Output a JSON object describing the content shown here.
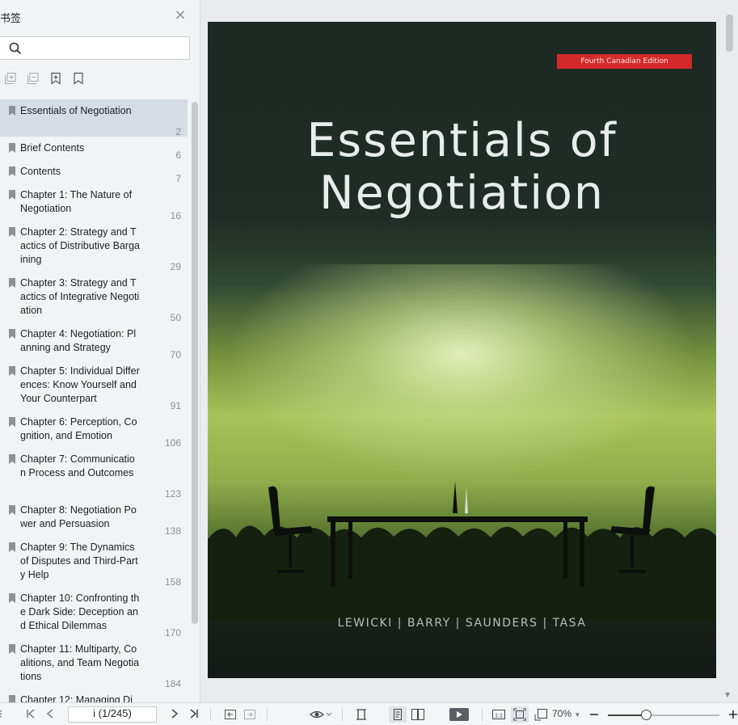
{
  "sidebar": {
    "title": "书签",
    "close_glyph": "×",
    "search": {
      "placeholder": "",
      "value": ""
    },
    "tools": [
      "expand-all-icon",
      "collapse-all-icon",
      "add-bookmark-icon",
      "bookmark-icon"
    ],
    "bookmarks": [
      {
        "label": "Essentials of   Negotiation",
        "page": "2",
        "selected": true
      },
      {
        "label": "Brief Contents",
        "page": "6"
      },
      {
        "label": "Contents",
        "page": "7"
      },
      {
        "label": "Chapter 1:  The Nature of Negotiation",
        "page": "16"
      },
      {
        "label": "Chapter 2:  Strategy and Tactics of Distributive Bargaining",
        "page": "29"
      },
      {
        "label": "Chapter 3:  Strategy and Tactics of Integrative Negotiation",
        "page": "50"
      },
      {
        "label": "Chapter 4:  Negotiation: Planning and Strategy",
        "page": "70"
      },
      {
        "label": "Chapter 5:  Individual Differences: Know Yourself and Your Counterpart",
        "page": "91"
      },
      {
        "label": "Chapter 6:  Perception, Cognition, and Emotion",
        "page": "106"
      },
      {
        "label": "Chapter 7:  Communication Process and Outcomes",
        "page": "123"
      },
      {
        "label": "Chapter 8:  Negotiation Power and Persuasion",
        "page": "138"
      },
      {
        "label": "Chapter 9:  The Dynamics of Disputes and Third-Party Help",
        "page": "158"
      },
      {
        "label": "Chapter 10: Confronting the Dark Side: Deception and  Ethical Dilemmas",
        "page": "170"
      },
      {
        "label": "Chapter 11: Multiparty, Coalitions, and Team Negotiations",
        "page": "184"
      },
      {
        "label": "Chapter 12: Managing Di",
        "page": ""
      }
    ]
  },
  "document": {
    "cover": {
      "edition_badge": "Fourth Canadian Edition",
      "title_line1": "Essentials of",
      "title_line2": "Negotiation",
      "authors": "LEWICKI  |  BARRY  |  SAUNDERS  |  TASA"
    }
  },
  "bottombar": {
    "page_indicator": "i (1/245)",
    "zoom": "70%"
  },
  "colors": {
    "selected_bookmark": "#d6dce6",
    "badge_red": "#d42a2a",
    "sidebar_bg": "#f2f3f5"
  }
}
